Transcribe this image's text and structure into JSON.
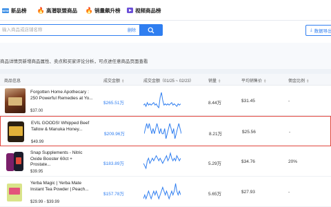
{
  "tabs": [
    {
      "label": "新品榜",
      "icon": "new-icon"
    },
    {
      "label": "高潜联盟商品",
      "icon": "fire-icon"
    },
    {
      "label": "销量飙升榜",
      "icon": "fire-icon"
    },
    {
      "label": "视频商品榜",
      "icon": "video-icon"
    }
  ],
  "search": {
    "placeholder": "输入商品或店铺名称",
    "clear_label": "删除",
    "button_icon": "search-icon"
  },
  "export": {
    "label": "数据导出",
    "icon": "download-icon"
  },
  "info_text": "商品详情页新增商品属性、卖点和买家评论分析，可点进任意商品页面查看",
  "table": {
    "headers": {
      "product": "商品信息",
      "sales_amount": "成交金额",
      "trend": "成交金额（01/25 ~ 02/23）",
      "quantity": "销量",
      "avg_price": "平均销售价",
      "commission": "佣金比例"
    },
    "rows": [
      {
        "name": "Forgotten Home Apothecary : 250 Powerful Remedies at Yo...",
        "price": "$37.00",
        "sales_amount": "$265.51万",
        "quantity": "8.44万",
        "avg_price": "$31.45",
        "commission": "-",
        "trend": [
          5,
          6,
          4,
          7,
          5,
          6,
          5,
          6,
          7,
          5,
          6,
          4,
          3,
          11,
          15,
          9,
          5,
          6,
          5,
          6,
          5,
          6,
          7,
          5,
          6,
          5,
          4,
          6,
          5,
          6
        ]
      },
      {
        "name": "EVIL GOODS! Whipped Beef Tallow & Manuka Honey...",
        "price": "$49.99",
        "sales_amount": "$209.96万",
        "quantity": "8.21万",
        "avg_price": "$25.56",
        "commission": "-",
        "trend": [
          5,
          6,
          7,
          6,
          7,
          6,
          5,
          6,
          5,
          6,
          7,
          6,
          5,
          6,
          5,
          5,
          6,
          4,
          5,
          6,
          7,
          6,
          5,
          6,
          4,
          5,
          6,
          7,
          6,
          5
        ]
      },
      {
        "name": "Snap Supplements - Nitric Oxide Booster 60ct + Prostate...",
        "price": "$39.95",
        "sales_amount": "$183.89万",
        "quantity": "5.29万",
        "avg_price": "$34.76",
        "commission": "20%",
        "trend": [
          4,
          3,
          2,
          5,
          6,
          4,
          5,
          6,
          5,
          6,
          7,
          6,
          5,
          6,
          5,
          4,
          5,
          6,
          7,
          5,
          6,
          8,
          6,
          5,
          6,
          5,
          7,
          6,
          5,
          6
        ]
      },
      {
        "name": "Yerba Magic | Yerba Mate Instant Tea Powder | Peach...",
        "price": "$29.99 - $39.99",
        "sales_amount": "$157.78万",
        "quantity": "5.65万",
        "avg_price": "$27.93",
        "commission": "-",
        "trend": [
          4,
          5,
          4,
          5,
          6,
          5,
          4,
          5,
          6,
          5,
          6,
          5,
          4,
          5,
          6,
          7,
          6,
          5,
          6,
          5,
          4,
          5,
          6,
          5,
          6,
          8,
          6,
          5,
          6,
          5
        ]
      }
    ]
  },
  "colors": {
    "accent": "#2f7ef0",
    "highlight": "#e0453c",
    "spark": "#2f7ef0"
  }
}
